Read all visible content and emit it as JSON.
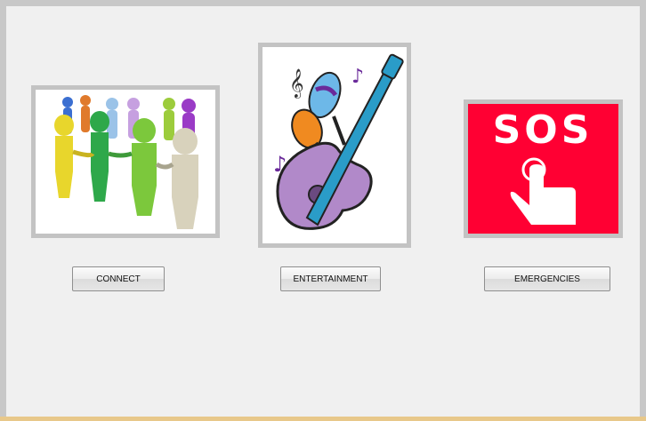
{
  "tiles": {
    "connect": {
      "icon": "people-circle-icon"
    },
    "entertainment": {
      "icon": "guitar-maracas-icon"
    },
    "emergency": {
      "icon": "sos-button-icon",
      "sos_text": "SOS",
      "bg_color": "#ff0033"
    }
  },
  "buttons": {
    "connect": "CONNECT",
    "entertainment": "ENTERTAINMENT",
    "emergencies": "EMERGENCIES"
  }
}
